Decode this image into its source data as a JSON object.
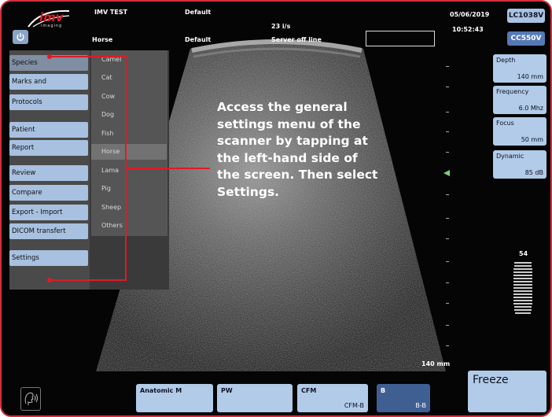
{
  "header": {
    "logo_main": "imv",
    "logo_sub": "imaging",
    "patient_name": "IMV TEST",
    "preset_top": "Default",
    "species": "Horse",
    "preset_bottom": "Default",
    "frame_rate": "23 i/s",
    "server_status": "Server off line",
    "date": "05/06/2019",
    "time": "10:52:43",
    "probe": "LC1038V",
    "scanner": "CC550V"
  },
  "menu": {
    "items": [
      "Species",
      "Marks and Annotations",
      "Protocols",
      "Patient",
      "Report",
      "Review",
      "Compare",
      "Export - Import",
      "DICOM transfert",
      "Settings"
    ],
    "species": [
      "Camel",
      "Cat",
      "Cow",
      "Dog",
      "Fish",
      "Horse",
      "Lama",
      "Pig",
      "Sheep",
      "Others"
    ],
    "selected_species": "Horse"
  },
  "params": {
    "depth_label": "Depth",
    "depth_value": "140 mm",
    "frequency_label": "Frequency",
    "frequency_value": "6.0 Mhz",
    "focus_label": "Focus",
    "focus_value": "50 mm",
    "dynamic_label": "Dynamic",
    "dynamic_value": "85 dB"
  },
  "gain_value": "54",
  "scale_label": "140 mm",
  "bottom": {
    "anatomic_m": "Anatomic M",
    "pw": "PW",
    "cfm": "CFM",
    "cfm_sub": "CFM-B",
    "b": "B",
    "b_sub": "B-B",
    "freeze": "Freeze"
  },
  "instruction": "Access the general settings menu of the scanner by tapping at the left-hand side of the screen. Then select Settings.",
  "colors": {
    "frame": "#d32f3a",
    "accent_red": "#e01b24",
    "button": "#b1cbe8",
    "active_button": "#3f5f93"
  }
}
